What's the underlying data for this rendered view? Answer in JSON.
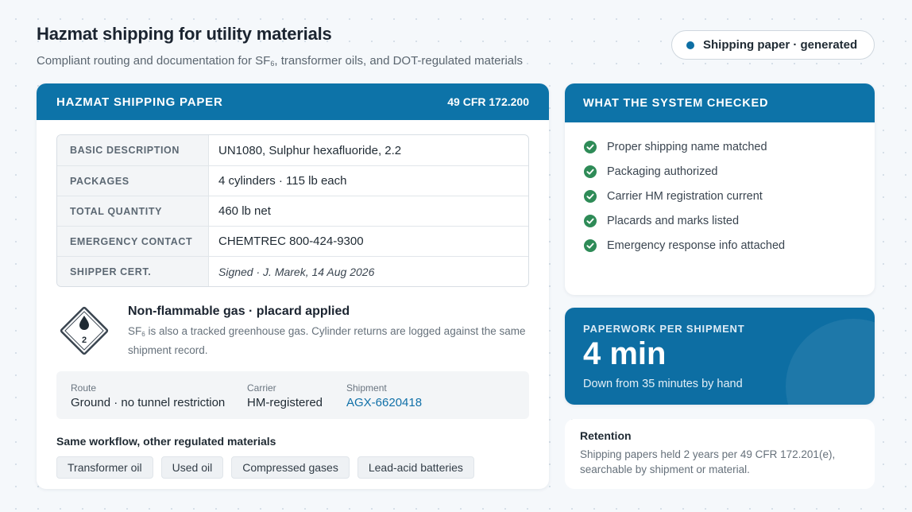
{
  "header": {
    "title": "Hazmat shipping for utility materials",
    "subtitle_prefix": "Compliant routing and documentation for SF",
    "subtitle_sub": "6",
    "subtitle_suffix": ", transformer oils, and DOT-regulated materials"
  },
  "status": {
    "label": "Shipping paper · generated",
    "dot_color": "#0d6fa4"
  },
  "shipping_paper": {
    "title": "HAZMAT SHIPPING PAPER",
    "regulation": "49 CFR 172.200",
    "rows": [
      {
        "label": "BASIC DESCRIPTION",
        "value": "UN1080, Sulphur hexafluoride, 2.2"
      },
      {
        "label": "PACKAGES",
        "value": "4 cylinders · 115 lb each"
      },
      {
        "label": "TOTAL QUANTITY",
        "value": "460 lb net"
      },
      {
        "label": "EMERGENCY CONTACT",
        "value": "CHEMTREC 800-424-9300"
      },
      {
        "label": "SHIPPER CERT.",
        "value": "Signed · J. Marek, 14 Aug 2026"
      }
    ],
    "placard": {
      "icon": "hazmat-class-2-placard-icon",
      "class_number": "2",
      "title": "Non-flammable gas · placard applied",
      "note_prefix": "SF",
      "note_sub": "6",
      "note_suffix": " is also a tracked greenhouse gas. Cylinder returns are logged against the same shipment record."
    },
    "details": [
      {
        "label": "Route",
        "value": "Ground · no tunnel restriction"
      },
      {
        "label": "Carrier",
        "value": "HM-registered"
      },
      {
        "label": "Shipment",
        "value": "AGX-6620418"
      }
    ],
    "workflow": {
      "title": "Same workflow, other regulated materials",
      "chips": [
        "Transformer oil",
        "Used oil",
        "Compressed gases",
        "Lead-acid batteries"
      ]
    }
  },
  "checks": {
    "title": "WHAT THE SYSTEM CHECKED",
    "icon": "check-circle-icon",
    "check_color": "#2e8b57",
    "items": [
      "Proper shipping name matched",
      "Packaging authorized",
      "Carrier HM registration current",
      "Placards and marks listed",
      "Emergency response info attached"
    ]
  },
  "paperwork": {
    "label": "PAPERWORK PER SHIPMENT",
    "value": "4 min",
    "note": "Down from 35 minutes by hand"
  },
  "retention": {
    "title": "Retention",
    "note": "Shipping papers held 2 years per 49 CFR 172.201(e), searchable by shipment or material."
  },
  "colors": {
    "accent": "#0d73a8",
    "link": "#1070a8",
    "check": "#2e8b57"
  }
}
